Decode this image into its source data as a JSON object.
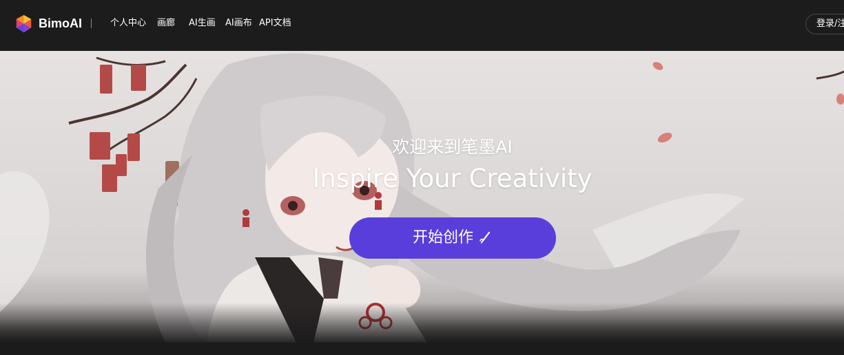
{
  "header": {
    "brand": "BimoAI",
    "nav": [
      {
        "label": "个人中心"
      },
      {
        "label": "画廊"
      },
      {
        "label": "AI生画"
      },
      {
        "label": "AI画布"
      },
      {
        "label": "API文档"
      }
    ],
    "login_label": "登录/注册"
  },
  "hero": {
    "title": "欢迎来到笔墨AI",
    "subtitle": "Inspire Your Creativity",
    "cta_label": "开始创作"
  },
  "colors": {
    "topbar_bg": "#1c1c1c",
    "cta_bg": "#5a3edb",
    "page_bg": "#1b1b1b"
  },
  "icons": {
    "logo": "bimoai-logo-icon",
    "cta_icon": "pen-icon"
  }
}
